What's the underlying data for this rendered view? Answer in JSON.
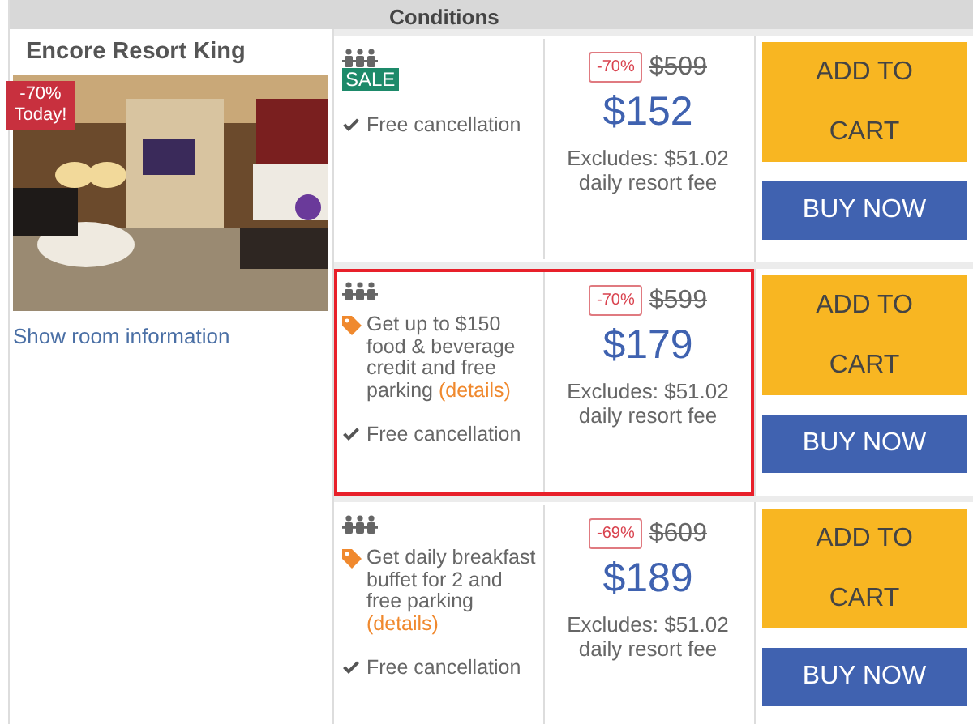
{
  "header": {
    "column_2": "Conditions"
  },
  "room": {
    "name": "Encore Resort King",
    "badge": "-70% Today!",
    "link": "Show room information"
  },
  "offers": [
    {
      "highlighted": false,
      "sale": "SALE",
      "cancellation": "Free cancellation",
      "discount": "-70%",
      "old_price": "$509",
      "price": "$152",
      "fee_note": "Excludes: $51.02 daily resort fee",
      "add_button": "ADD TO CART",
      "buy_button": "BUY NOW"
    },
    {
      "highlighted": true,
      "perk": "Get up to $150 food & beverage credit and free parking",
      "perk_link": "(details)",
      "cancellation": "Free cancellation",
      "discount": "-70%",
      "old_price": "$599",
      "price": "$179",
      "fee_note": "Excludes: $51.02 daily resort fee",
      "add_button": "ADD TO CART",
      "buy_button": "BUY NOW"
    },
    {
      "highlighted": false,
      "perk": "Get daily breakfast buffet for 2 and free parking",
      "perk_link": "(details)",
      "cancellation": "Free cancellation",
      "discount": "-69%",
      "old_price": "$609",
      "price": "$189",
      "fee_note": "Excludes: $51.02 daily resort fee",
      "add_button": "ADD TO CART",
      "buy_button": "BUY NOW"
    }
  ]
}
